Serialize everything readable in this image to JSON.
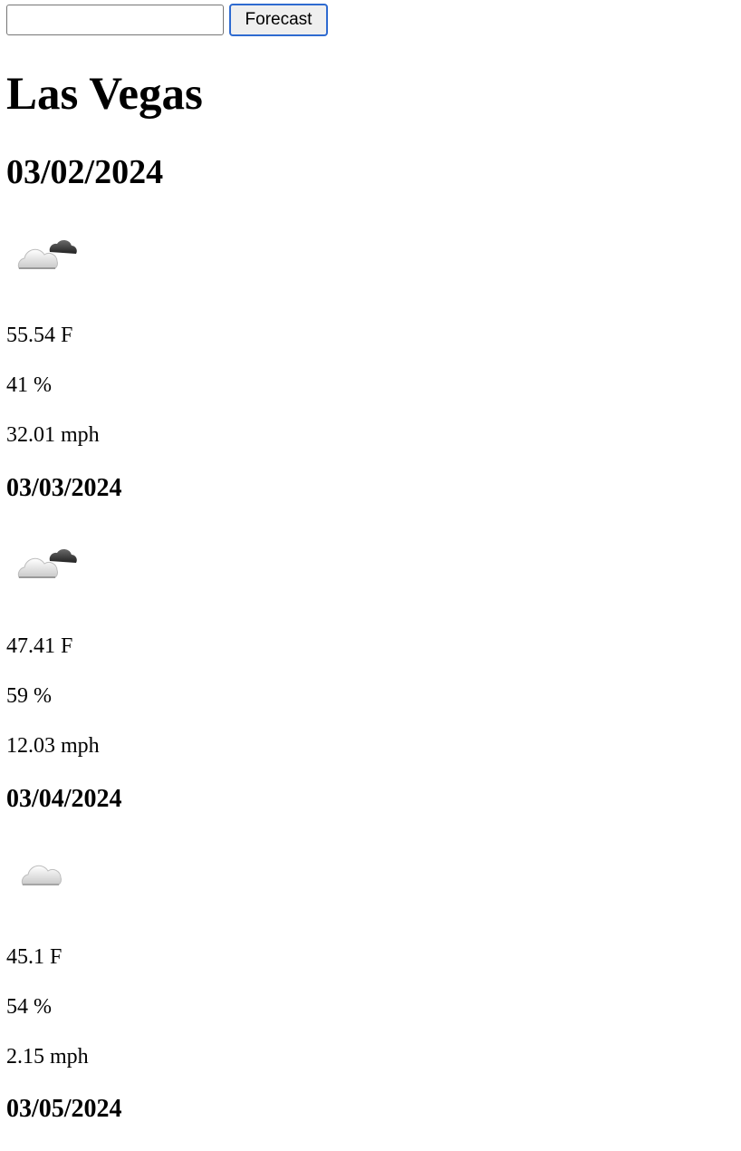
{
  "search": {
    "value": "",
    "button_label": "Forecast"
  },
  "city": "Las Vegas",
  "days": [
    {
      "date": "03/02/2024",
      "icon": "partly-cloudy-icon",
      "temp": "55.54 F",
      "humidity": "41 %",
      "wind": "32.01 mph"
    },
    {
      "date": "03/03/2024",
      "icon": "partly-cloudy-icon",
      "temp": "47.41 F",
      "humidity": "59 %",
      "wind": "12.03 mph"
    },
    {
      "date": "03/04/2024",
      "icon": "cloud-icon",
      "temp": "45.1 F",
      "humidity": "54 %",
      "wind": "2.15 mph"
    },
    {
      "date": "03/05/2024"
    }
  ]
}
